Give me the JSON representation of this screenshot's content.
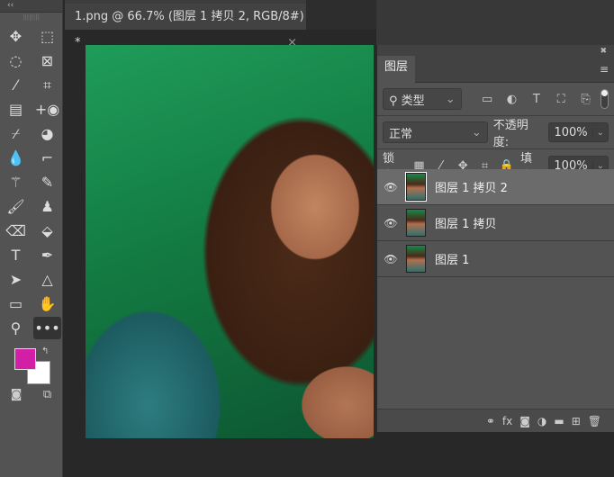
{
  "toolbar": {
    "collapse": "‹‹",
    "grip": "||||||||",
    "tools": [
      {
        "name": "move-tool",
        "glyph": "✥"
      },
      {
        "name": "marquee-tool",
        "glyph": "⬚"
      },
      {
        "name": "lasso-tool",
        "glyph": "◌"
      },
      {
        "name": "frame-tool",
        "glyph": "⊠"
      },
      {
        "name": "quick-select-tool",
        "glyph": "⁄"
      },
      {
        "name": "perspective-crop-tool",
        "glyph": "⌗"
      },
      {
        "name": "gradient-tool",
        "glyph": "▤"
      },
      {
        "name": "red-eye-tool",
        "glyph": "+◉"
      },
      {
        "name": "eyedropper-tool",
        "glyph": "⌿"
      },
      {
        "name": "smudge-tool",
        "glyph": "◕"
      },
      {
        "name": "blur-tool",
        "glyph": "💧"
      },
      {
        "name": "crop-tool",
        "glyph": "⌐"
      },
      {
        "name": "magic-wand-tool",
        "glyph": "⚚"
      },
      {
        "name": "healing-brush-tool",
        "glyph": "✎"
      },
      {
        "name": "brush-tool",
        "glyph": "🖌"
      },
      {
        "name": "stamp-tool",
        "glyph": "♟"
      },
      {
        "name": "eraser-tool",
        "glyph": "⌫"
      },
      {
        "name": "paint-bucket-tool",
        "glyph": "⬙"
      },
      {
        "name": "type-tool",
        "glyph": "T"
      },
      {
        "name": "pen-tool",
        "glyph": "✒"
      },
      {
        "name": "path-select-tool",
        "glyph": "➤"
      },
      {
        "name": "shape-tool",
        "glyph": "△"
      },
      {
        "name": "rectangle-tool",
        "glyph": "▭"
      },
      {
        "name": "hand-tool",
        "glyph": "✋"
      },
      {
        "name": "zoom-tool",
        "glyph": "⚲"
      },
      {
        "name": "more-tools",
        "glyph": "•••"
      }
    ],
    "foreground_color": "#d21fa5",
    "background_color": "#ffffff",
    "swap": "↰",
    "quick_mask": "◙",
    "screen_mode": "⧉"
  },
  "document": {
    "tab_title": "1.png @ 66.7% (图层 1 拷贝 2, RGB/8#) *",
    "close": "×"
  },
  "layers_panel": {
    "collapse": "‹‹",
    "close": "✖",
    "tab": "图层",
    "menu": "≡",
    "filter": {
      "icon": "⚲",
      "value": "类型",
      "chev": "⌄"
    },
    "filter_icons": [
      "▭",
      "◐",
      "T",
      "⛶",
      "⎘"
    ],
    "blend_mode": "正常",
    "chev": "⌄",
    "opacity_label": "不透明度:",
    "opacity": "100%",
    "lock_label": "锁定:",
    "lock_icons": [
      "▦",
      "⁄",
      "✥",
      "⌗",
      "🔒"
    ],
    "fill_label": "填充:",
    "fill": "100%",
    "layers": [
      {
        "name": "图层 1 拷贝 2",
        "active": true
      },
      {
        "name": "图层 1 拷贝",
        "active": false
      },
      {
        "name": "图层 1",
        "active": false
      }
    ],
    "eye": "👁",
    "bottom_icons": [
      "⚭",
      "fx",
      "◙",
      "◑",
      "▬",
      "⊞",
      "🗑"
    ]
  }
}
